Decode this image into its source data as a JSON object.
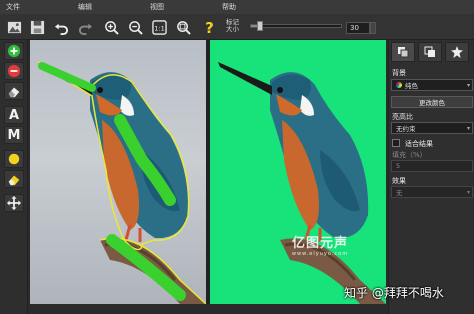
{
  "menubar": {
    "items": [
      "文件",
      "编辑",
      "视图",
      "帮助"
    ]
  },
  "toolbar": {
    "brush_label_line1": "标记",
    "brush_label_line2": "大小",
    "brush_size": "30",
    "brush_size_level": 0.1,
    "icons": [
      "save-icon",
      "undo-icon",
      "redo-icon",
      "zoom-in-icon",
      "zoom-out-icon",
      "zoom-actual-icon",
      "zoom-fit-icon",
      "help-icon"
    ]
  },
  "tools": {
    "text_tool_label": "A",
    "mark_tool_label": "M",
    "icons": [
      "add-icon",
      "remove-icon",
      "eraser-icon",
      "color-dot-icon",
      "eraser-alt-icon",
      "move-icon"
    ]
  },
  "right_panel": {
    "background_label": "背景",
    "background_value": "纯色",
    "change_color_button": "更改颜色",
    "highlight_label": "亮高比",
    "highlight_value": "无约束",
    "fit_result_label": "适合结果",
    "padding_label": "填充（%）",
    "padding_value": "5",
    "effect_label": "效果",
    "effect_value": "无"
  },
  "watermark": {
    "main": "亿图元声",
    "sub": "www.eiyuyo.com"
  },
  "overlay_text": "知乎 @拜拜不喝水",
  "colors": {
    "green_background": "#18e27a",
    "mark_green": "#3ad12f",
    "outline_yellow": "#e8e83a"
  }
}
